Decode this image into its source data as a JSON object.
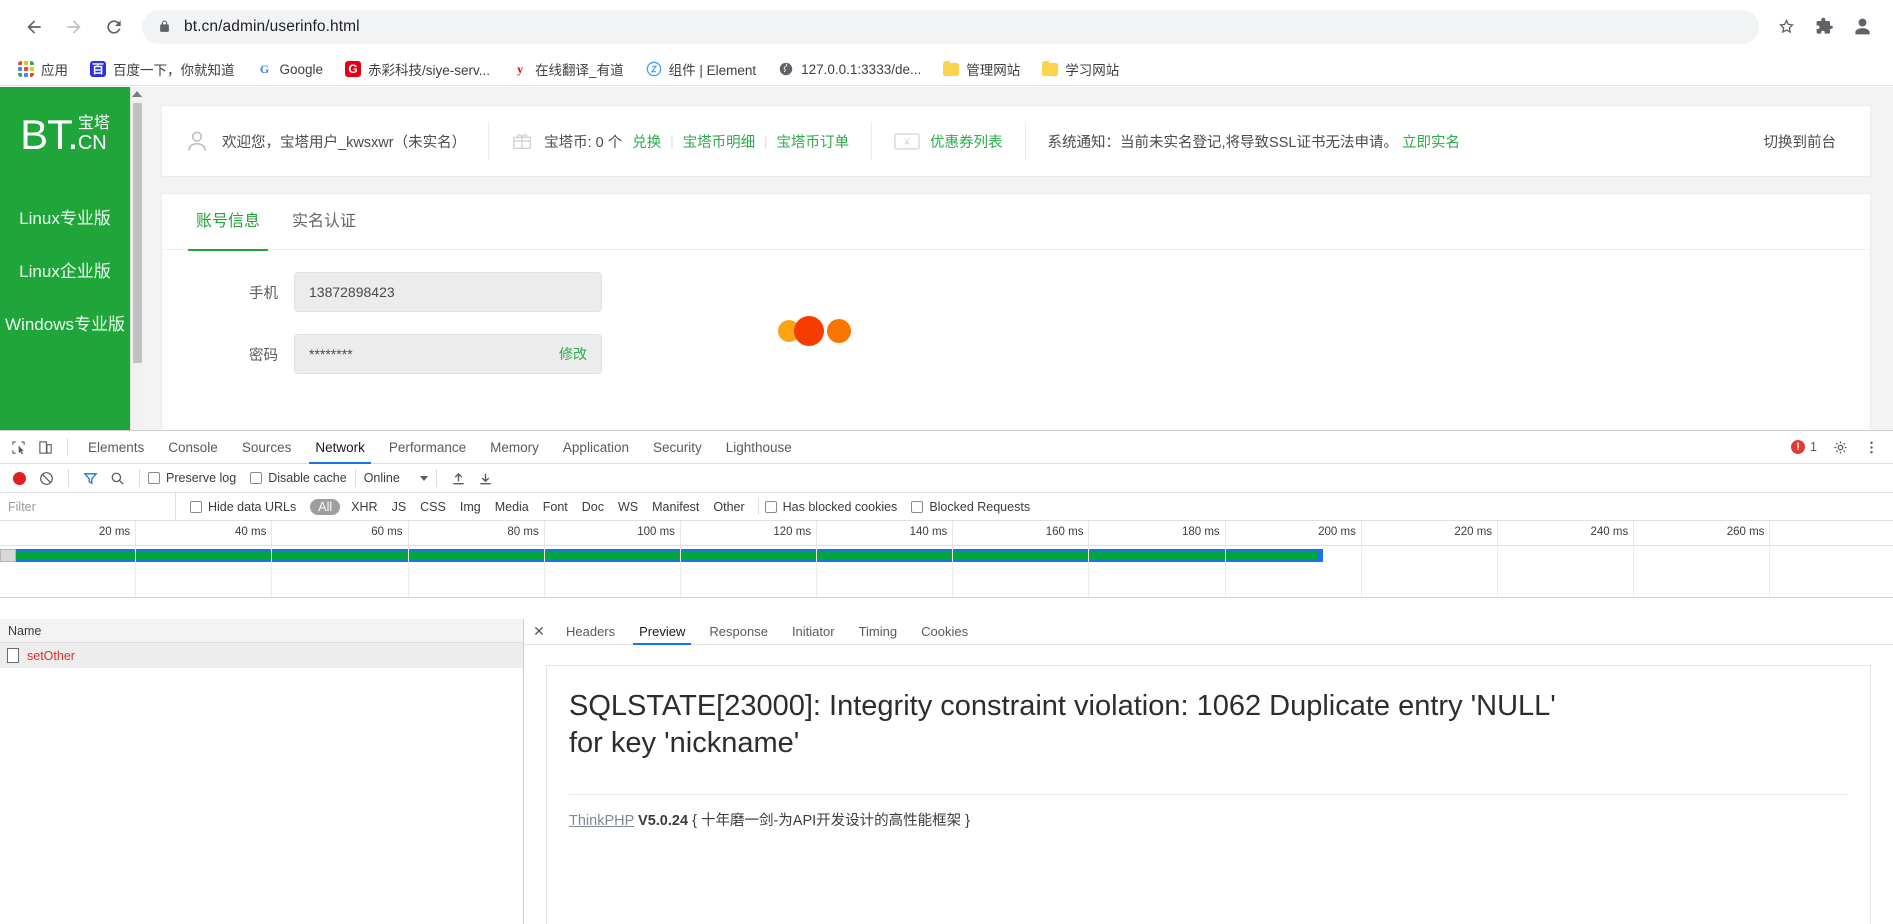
{
  "browser": {
    "back_label": "back-arrow",
    "forward_label": "forward-arrow",
    "reload_label": "reload",
    "url": "bt.cn/admin/userinfo.html",
    "star_label": "bookmark-star",
    "extensions_label": "extensions-puzzle",
    "profile_label": "profile-avatar",
    "bookmarks": [
      {
        "label": "应用",
        "icon": "apps-grid-icon"
      },
      {
        "label": "百度一下，你就知道",
        "icon": "baidu-icon"
      },
      {
        "label": "Google",
        "icon": "google-icon"
      },
      {
        "label": "赤彩科技/siye-serv...",
        "icon": "gitee-icon"
      },
      {
        "label": "在线翻译_有道",
        "icon": "youdao-icon"
      },
      {
        "label": "组件 | Element",
        "icon": "element-icon"
      },
      {
        "label": "127.0.0.1:3333/de...",
        "icon": "globe-icon"
      },
      {
        "label": "管理网站",
        "icon": "folder-icon"
      },
      {
        "label": "学习网站",
        "icon": "folder-icon"
      }
    ]
  },
  "bt_panel": {
    "logo": {
      "bt": "BT.",
      "cn_top": "宝塔",
      "cn_bottom": "CN"
    },
    "nav": [
      {
        "label": "Linux专业版"
      },
      {
        "label": "Linux企业版"
      },
      {
        "label": "Windows专业版"
      }
    ],
    "topbar": {
      "welcome": "欢迎您，宝塔用户_kwsxwr",
      "unverified": "（未实名）",
      "coin_text": "宝塔币: 0 个",
      "exchange": "兑换",
      "coin_detail": "宝塔币明细",
      "coin_order": "宝塔币订单",
      "coupon_list": "优惠券列表",
      "notice_label": "系统通知：",
      "notice_text": "当前未实名登记,将导致SSL证书无法申请。",
      "notice_action": "立即实名",
      "switch_front": "切换到前台"
    },
    "tabs": [
      {
        "label": "账号信息",
        "active": true
      },
      {
        "label": "实名认证",
        "active": false
      }
    ],
    "form": {
      "phone_label": "手机",
      "phone_value": "13872898423",
      "password_label": "密码",
      "password_value": "********",
      "modify_label": "修改"
    },
    "loading_dots": [
      "#fca311",
      "#f63c00",
      "#fb7501"
    ]
  },
  "devtools": {
    "panels": [
      {
        "label": "Elements",
        "active": false
      },
      {
        "label": "Console",
        "active": false
      },
      {
        "label": "Sources",
        "active": false
      },
      {
        "label": "Network",
        "active": true
      },
      {
        "label": "Performance",
        "active": false
      },
      {
        "label": "Memory",
        "active": false
      },
      {
        "label": "Application",
        "active": false
      },
      {
        "label": "Security",
        "active": false
      },
      {
        "label": "Lighthouse",
        "active": false
      }
    ],
    "error_count": "1",
    "toolbar": {
      "record_label": "record",
      "clear_label": "clear",
      "filter_label": "filter",
      "search_label": "search",
      "preserve_log": "Preserve log",
      "disable_cache": "Disable cache",
      "throttling": "Online",
      "import_label": "import-har",
      "export_label": "export-har"
    },
    "filterbar": {
      "filter_placeholder": "Filter",
      "hide_data_urls": "Hide data URLs",
      "types": [
        "All",
        "XHR",
        "JS",
        "CSS",
        "Img",
        "Media",
        "Font",
        "Doc",
        "WS",
        "Manifest",
        "Other"
      ],
      "has_blocked_cookies": "Has blocked cookies",
      "blocked_requests": "Blocked Requests"
    },
    "timeline": {
      "ticks": [
        "20 ms",
        "40 ms",
        "60 ms",
        "80 ms",
        "100 ms",
        "120 ms",
        "140 ms",
        "160 ms",
        "180 ms",
        "200 ms",
        "220 ms",
        "240 ms",
        "260 ms"
      ],
      "bar_color_outer": "#1a73e8",
      "bar_color_inner": "#00a53c",
      "bar_end_ratio": 0.699
    },
    "requests": {
      "column_name": "Name",
      "rows": [
        {
          "name": "setOther"
        }
      ]
    },
    "preview": {
      "tabs": [
        {
          "label": "Headers",
          "active": false
        },
        {
          "label": "Preview",
          "active": true
        },
        {
          "label": "Response",
          "active": false
        },
        {
          "label": "Initiator",
          "active": false
        },
        {
          "label": "Timing",
          "active": false
        },
        {
          "label": "Cookies",
          "active": false
        }
      ],
      "error_message": "SQLSTATE[23000]: Integrity constraint violation: 1062 Duplicate entry 'NULL' for key 'nickname'",
      "framework_link": "ThinkPHP",
      "framework_version": "V5.0.24",
      "framework_slogan": "{ 十年磨一剑-为API开发设计的高性能框架 }"
    }
  }
}
